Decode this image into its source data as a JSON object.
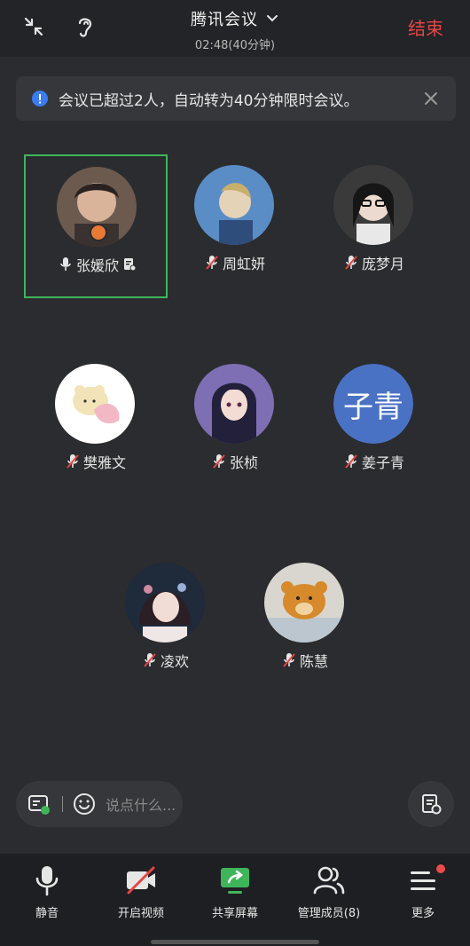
{
  "header": {
    "title": "腾讯会议",
    "timer": "02:48(40分钟)",
    "end_label": "结束",
    "icons": [
      "minimize-icon",
      "ear-icon",
      "chevron-down-icon"
    ]
  },
  "notice": {
    "text": "会议已超过2人，自动转为40分钟限时会议。",
    "icons": [
      "info-icon",
      "close-icon"
    ]
  },
  "participants": [
    {
      "name": "张媛欣",
      "muted": false,
      "host": true,
      "active": true
    },
    {
      "name": "周虹妍",
      "muted": true
    },
    {
      "name": "庞梦月",
      "muted": true
    },
    {
      "name": "樊雅文",
      "muted": true
    },
    {
      "name": "张桢",
      "muted": true
    },
    {
      "name": "姜子青",
      "muted": true,
      "avatar_text": "子青"
    },
    {
      "name": "凌欢",
      "muted": true
    },
    {
      "name": "陈慧",
      "muted": true
    }
  ],
  "chat": {
    "placeholder": "说点什么..."
  },
  "toolbar": {
    "mute": "静音",
    "video": "开启视频",
    "share": "共享屏幕",
    "members": "管理成员(8)",
    "more": "更多"
  },
  "colors": {
    "background": "#2b2c2f",
    "accent_green": "#3fb55a",
    "end_red": "#e64545",
    "host_badge": "#e87a35",
    "notice_icon": "#3b7cf2"
  }
}
